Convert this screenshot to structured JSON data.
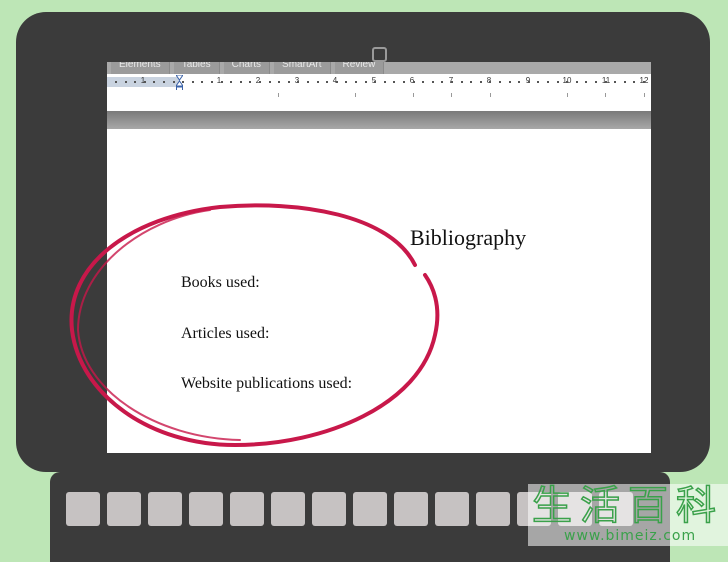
{
  "ribbon": {
    "tabs": [
      "Elements",
      "Tables",
      "Charts",
      "SmartArt",
      "Review"
    ]
  },
  "ruler": {
    "labels": [
      "1",
      "1",
      "2",
      "3",
      "4",
      "5",
      "6",
      "7",
      "8",
      "9",
      "10",
      "11",
      "12"
    ]
  },
  "document": {
    "title": "Bibliography",
    "lines": [
      "Books used:",
      "Articles used:",
      "Website publications used:"
    ]
  },
  "annotation": {
    "circle_color": "#c8184a"
  },
  "watermark": {
    "chars": [
      "生",
      "活",
      "百",
      "科"
    ],
    "url": "www.bimeiz.com"
  },
  "colors": {
    "background": "#bde6b6",
    "device": "#3b3b3b",
    "key": "#c6c2c2"
  }
}
